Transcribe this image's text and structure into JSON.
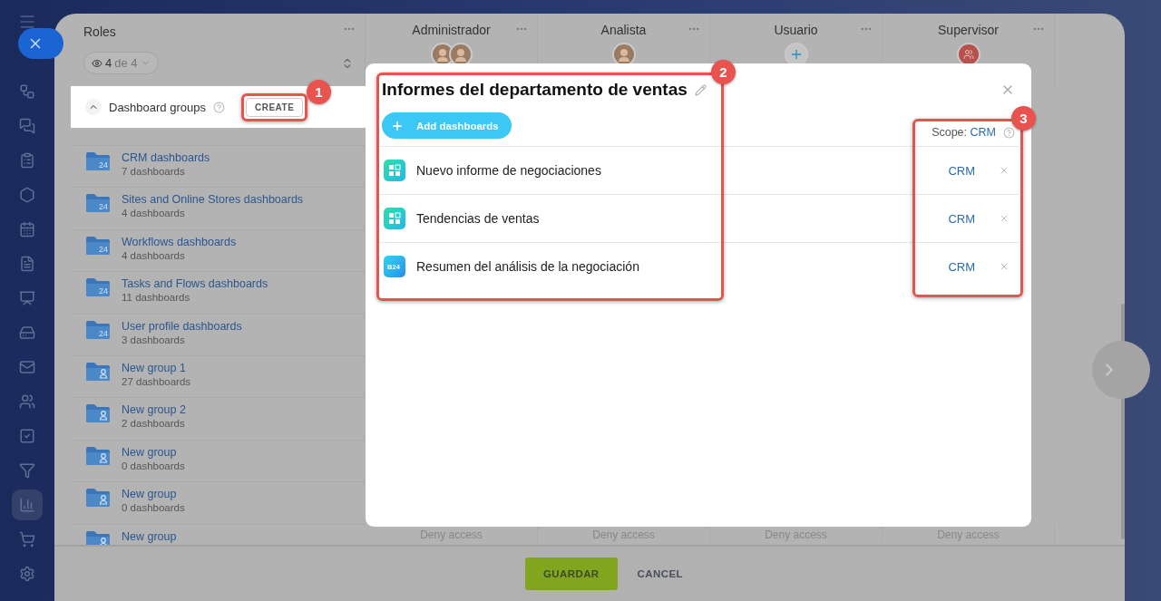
{
  "sidebar": {
    "items": [
      {
        "selected": false
      },
      {
        "selected": false
      },
      {
        "selected": false
      },
      {
        "selected": false
      },
      {
        "selected": false
      },
      {
        "selected": false
      },
      {
        "selected": false
      },
      {
        "selected": false
      },
      {
        "selected": false
      },
      {
        "selected": false
      },
      {
        "selected": false
      },
      {
        "selected": false
      },
      {
        "selected": true
      },
      {
        "selected": false
      },
      {
        "selected": false
      }
    ]
  },
  "roles_column": {
    "title": "Roles",
    "filter": {
      "count": "4",
      "total": "de 4"
    }
  },
  "role_columns": [
    {
      "name": "Administrador",
      "avatars": [
        {
          "kind": "photo"
        },
        {
          "kind": "photo"
        }
      ]
    },
    {
      "name": "Analista",
      "avatars": [
        {
          "kind": "photo"
        }
      ]
    },
    {
      "name": "Usuario",
      "avatars": [
        {
          "kind": "add"
        }
      ]
    },
    {
      "name": "Supervisor",
      "avatars": [
        {
          "kind": "group"
        }
      ]
    }
  ],
  "section": {
    "title": "Dashboard groups",
    "expanded": true,
    "create_button": "CREATE"
  },
  "groups": [
    {
      "name": "CRM dashboards",
      "count": "7 dashboards",
      "kind": "system",
      "badge": "24"
    },
    {
      "name": "Sites and Online Stores dashboards",
      "count": "4 dashboards",
      "kind": "system",
      "badge": "24"
    },
    {
      "name": "Workflows dashboards",
      "count": "4 dashboards",
      "kind": "system",
      "badge": "24"
    },
    {
      "name": "Tasks and Flows dashboards",
      "count": "11 dashboards",
      "kind": "system",
      "badge": "24"
    },
    {
      "name": "User profile dashboards",
      "count": "3 dashboards",
      "kind": "system",
      "badge": "24"
    },
    {
      "name": "New group 1",
      "count": "27 dashboards",
      "kind": "custom"
    },
    {
      "name": "New group 2",
      "count": "2 dashboards",
      "kind": "custom"
    },
    {
      "name": "New group",
      "count": "0 dashboards",
      "kind": "custom"
    },
    {
      "name": "New group",
      "count": "0 dashboards",
      "kind": "custom"
    },
    {
      "name": "New group",
      "kind": "custom",
      "access": [
        "Deny access",
        "Deny access",
        "Deny access",
        "Deny access"
      ]
    }
  ],
  "modal": {
    "title": "Informes del departamento de ventas",
    "add_button": "Add dashboards",
    "scope_label": "Scope:",
    "scope_value": "CRM",
    "rows": [
      {
        "name": "Nuevo informe de negociaciones",
        "kind": "report",
        "scope": "CRM"
      },
      {
        "name": "Tendencias de ventas",
        "kind": "report",
        "scope": "CRM"
      },
      {
        "name": "Resumen del análisis de la negociación",
        "kind": "b24",
        "icon_text": "B24",
        "scope": "CRM"
      }
    ]
  },
  "footer": {
    "save": "GUARDAR",
    "cancel": "CANCEL"
  },
  "annotations": [
    {
      "label": "1"
    },
    {
      "label": "2"
    },
    {
      "label": "3"
    }
  ]
}
